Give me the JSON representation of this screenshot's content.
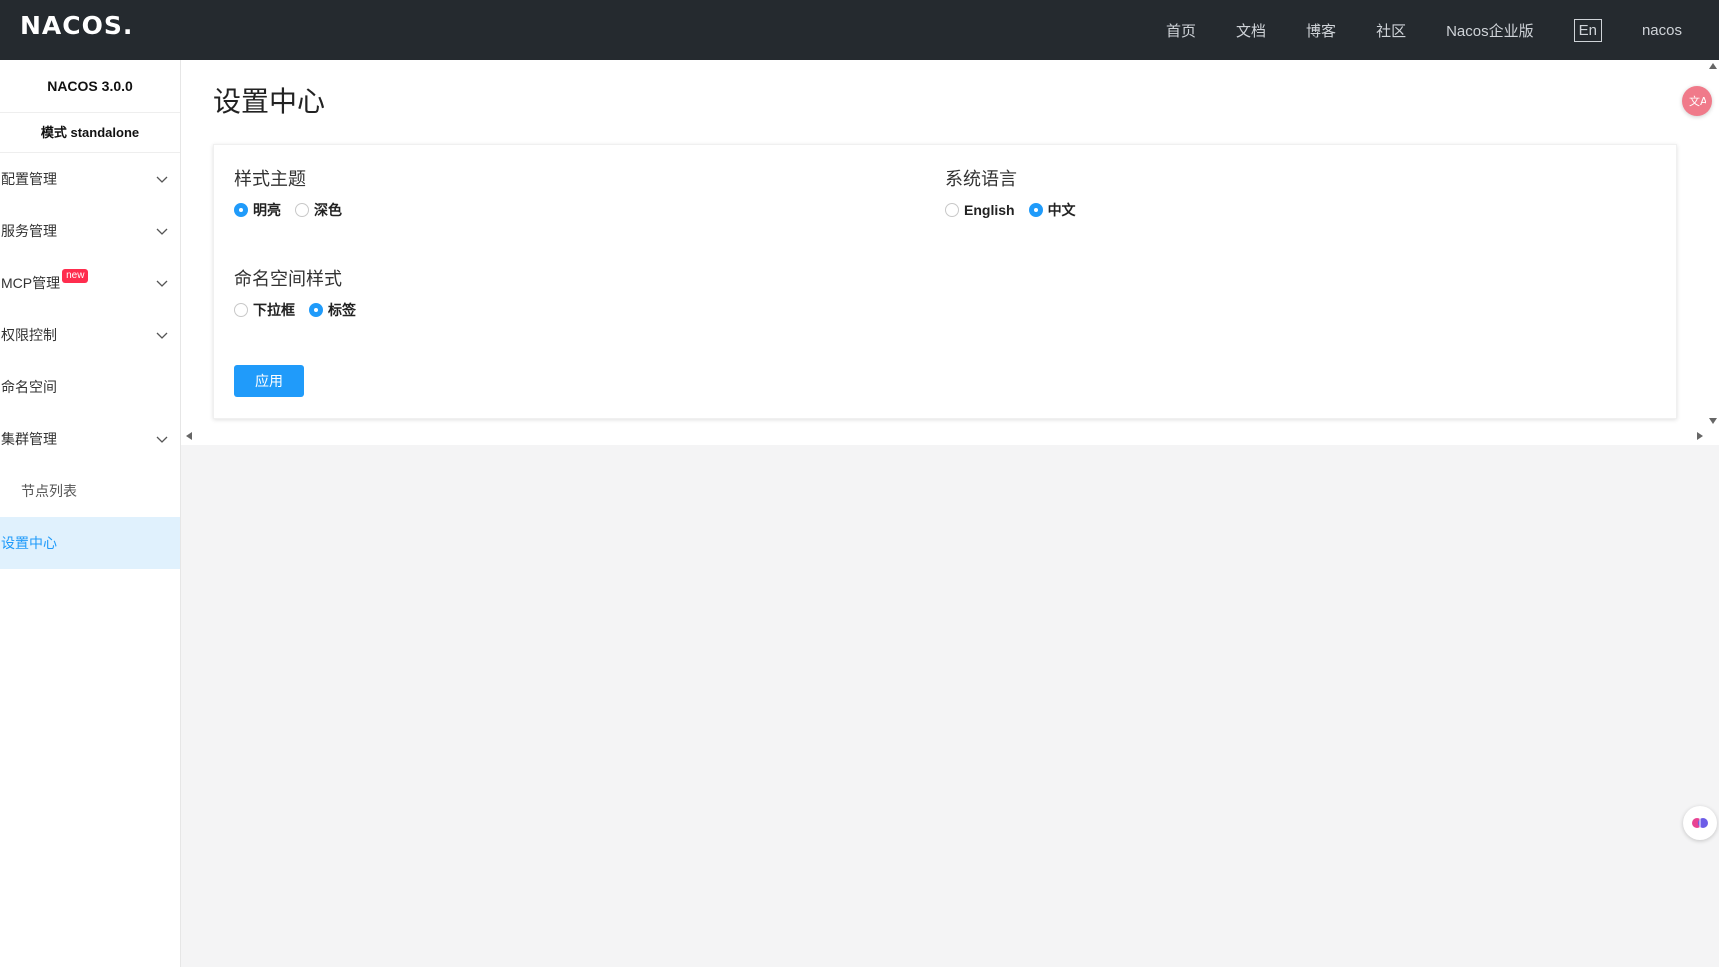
{
  "header": {
    "logo": "NACOS.",
    "nav": [
      "首页",
      "文档",
      "博客",
      "社区",
      "Nacos企业版"
    ],
    "lang_toggle": "En",
    "user": "nacos"
  },
  "sidebar": {
    "version": "NACOS 3.0.0",
    "mode": "模式 standalone",
    "items": [
      {
        "label": "配置管理",
        "expandable": true
      },
      {
        "label": "服务管理",
        "expandable": true
      },
      {
        "label": "MCP管理",
        "badge": "new",
        "expandable": true
      },
      {
        "label": "权限控制",
        "expandable": true
      },
      {
        "label": "命名空间",
        "expandable": false
      },
      {
        "label": "集群管理",
        "expandable": true
      },
      {
        "label": "节点列表",
        "sub": true
      },
      {
        "label": "设置中心",
        "active": true
      }
    ]
  },
  "page": {
    "title": "设置中心",
    "theme": {
      "title": "样式主题",
      "options": [
        "明亮",
        "深色"
      ],
      "selected": "明亮"
    },
    "language": {
      "title": "系统语言",
      "options": [
        "English",
        "中文"
      ],
      "selected": "中文"
    },
    "namespace_style": {
      "title": "命名空间样式",
      "options": [
        "下拉框",
        "标签"
      ],
      "selected": "标签"
    },
    "apply_label": "应用"
  },
  "colors": {
    "accent": "#209bfa",
    "header_bg": "#252a2f",
    "active_bg": "#e0f1fd",
    "badge": "#ff2d4e"
  }
}
